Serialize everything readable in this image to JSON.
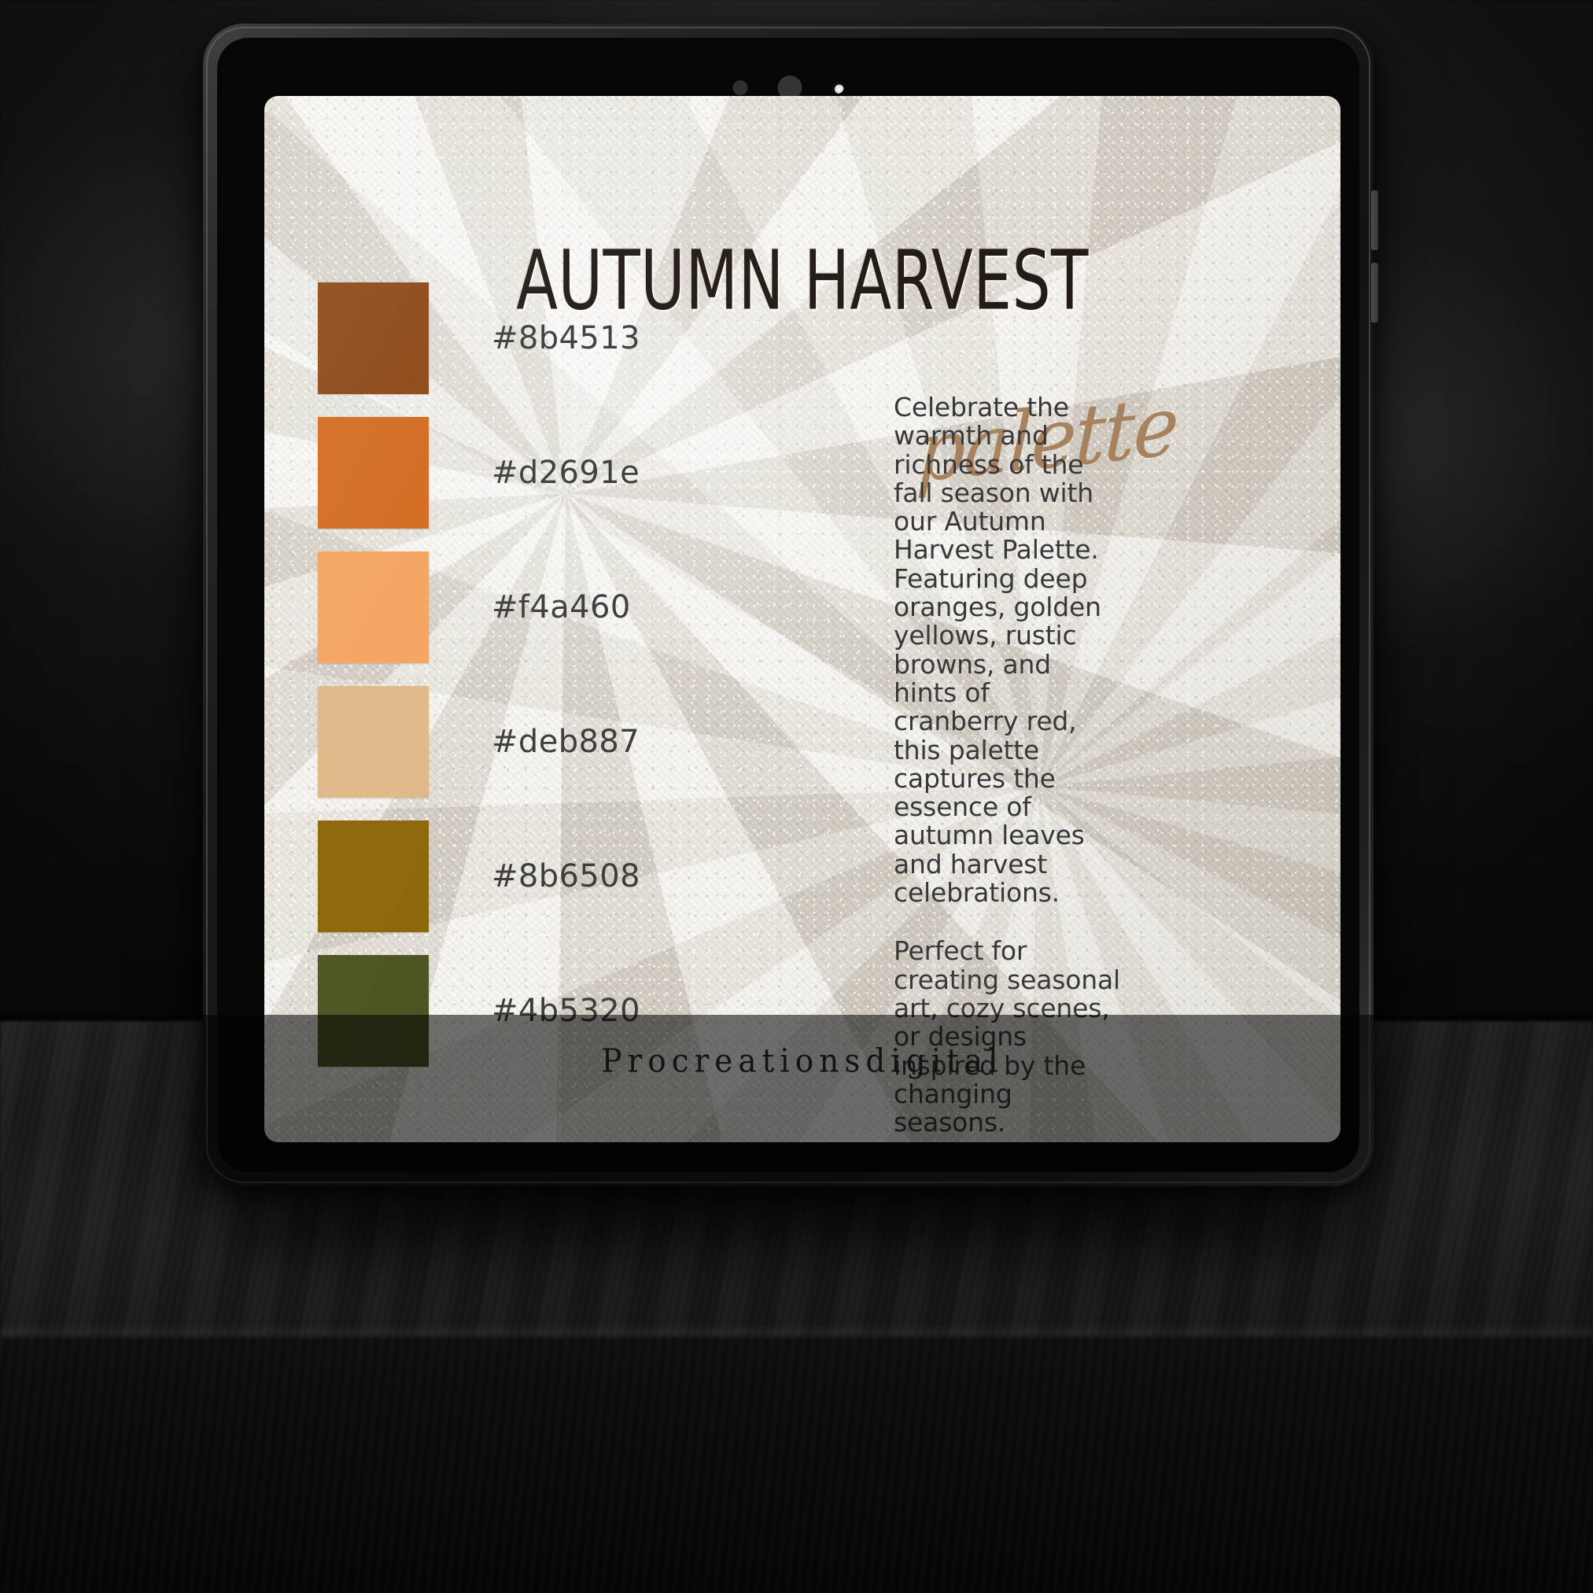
{
  "device": {
    "type": "tablet",
    "sensors": [
      "sensor-small",
      "sensor-camera",
      "sensor-indicator-led"
    ],
    "side_buttons": [
      "volume-up",
      "volume-down"
    ]
  },
  "card": {
    "title": "AUTUMN HARVEST",
    "script_label": "palette",
    "footer_brand": "Procreationsdigital",
    "background_color": "#ece8df"
  },
  "swatches": [
    {
      "hex": "#8b4513",
      "label": "#8b4513"
    },
    {
      "hex": "#d2691e",
      "label": "#d2691e"
    },
    {
      "hex": "#f4a460",
      "label": "#f4a460"
    },
    {
      "hex": "#deb887",
      "label": "#deb887"
    },
    {
      "hex": "#8b6508",
      "label": "#8b6508"
    },
    {
      "hex": "#4b5320",
      "label": "#4b5320"
    }
  ],
  "description": {
    "paragraph_1": "Celebrate the warmth and richness of the fall season with our Autumn Harvest Palette. Featuring deep oranges, golden yellows, rustic browns, and hints of cranberry red, this palette captures the essence of autumn leaves and harvest celebrations.",
    "paragraph_2": "Perfect for creating seasonal art, cozy scenes, or designs inspired by the changing seasons."
  },
  "colors": {
    "title_text": "#231c16",
    "script_text": "#a7825e",
    "body_text": "#38383a",
    "hex_label_text": "#3d3d3c",
    "footer_text": "#2f2a25"
  },
  "scene": {
    "backdrop": "dark-blurred-wall",
    "surface": "dark-wooden-table"
  }
}
